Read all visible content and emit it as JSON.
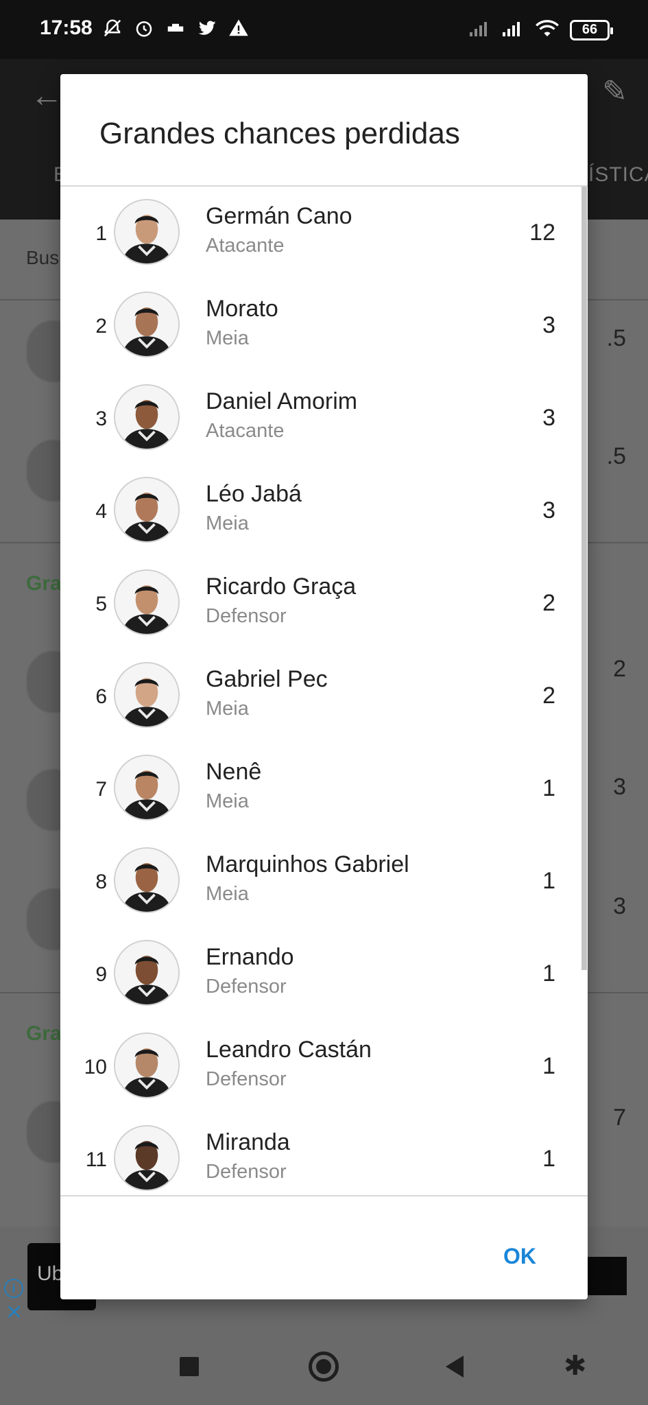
{
  "status_bar": {
    "time": "17:58",
    "battery": "66",
    "left_icons": [
      "mute-bell-icon",
      "alarm-icon",
      "bed-icon",
      "twitter-icon",
      "warning-icon"
    ],
    "right_icons": [
      "signal-off-icon",
      "signal-icon",
      "wifi-icon",
      "battery-icon"
    ]
  },
  "background": {
    "tab_left": "E",
    "tab_right": "ÍSTICA",
    "search_text": "Bus",
    "section_labels": [
      "Gra",
      "Gra"
    ],
    "numbers": [
      ".5",
      ".5",
      "2",
      "3",
      "3",
      "7"
    ],
    "ad_text": "Ub"
  },
  "dialog": {
    "title": "Grandes chances perdidas",
    "players": [
      {
        "rank": "1",
        "name": "Germán Cano",
        "position": "Atacante",
        "value": "12"
      },
      {
        "rank": "2",
        "name": "Morato",
        "position": "Meia",
        "value": "3"
      },
      {
        "rank": "3",
        "name": "Daniel Amorim",
        "position": "Atacante",
        "value": "3"
      },
      {
        "rank": "4",
        "name": "Léo Jabá",
        "position": "Meia",
        "value": "3"
      },
      {
        "rank": "5",
        "name": "Ricardo Graça",
        "position": "Defensor",
        "value": "2"
      },
      {
        "rank": "6",
        "name": "Gabriel Pec",
        "position": "Meia",
        "value": "2"
      },
      {
        "rank": "7",
        "name": "Nenê",
        "position": "Meia",
        "value": "1"
      },
      {
        "rank": "8",
        "name": "Marquinhos Gabriel",
        "position": "Meia",
        "value": "1"
      },
      {
        "rank": "9",
        "name": "Ernando",
        "position": "Defensor",
        "value": "1"
      },
      {
        "rank": "10",
        "name": "Leandro Castán",
        "position": "Defensor",
        "value": "1"
      },
      {
        "rank": "11",
        "name": "Miranda",
        "position": "Defensor",
        "value": "1"
      }
    ],
    "ok_label": "OK"
  },
  "nav_bar": {
    "icons": [
      "recents-square-icon",
      "home-circle-icon",
      "back-triangle-icon",
      "accessibility-icon"
    ]
  },
  "colors": {
    "accent": "#1a86d8",
    "section_green": "#3e6b3e"
  }
}
